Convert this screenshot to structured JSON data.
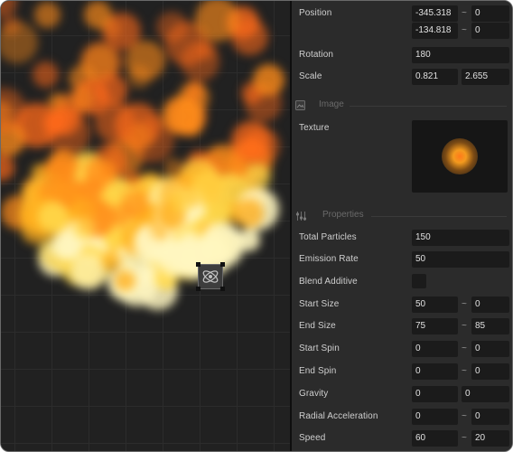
{
  "canvas": {
    "emitter_icon": "atom-icon",
    "particle_colors": [
      "#ff6a1a",
      "#ff8c1a",
      "#ffb020",
      "#ffd84a",
      "#fff6c0"
    ]
  },
  "inspector": {
    "position": {
      "label": "Position",
      "x": "-345.318",
      "x_var": "0",
      "y": "-134.818",
      "y_var": "0",
      "sep": "~"
    },
    "rotation": {
      "label": "Rotation",
      "value": "180"
    },
    "scale": {
      "label": "Scale",
      "x": "0.821",
      "y": "2.655"
    },
    "image_section": {
      "title": "Image",
      "icon": "image-icon"
    },
    "texture": {
      "label": "Texture"
    },
    "properties_section": {
      "title": "Properties",
      "icon": "sliders-icon"
    },
    "total_particles": {
      "label": "Total Particles",
      "value": "150"
    },
    "emission_rate": {
      "label": "Emission Rate",
      "value": "50"
    },
    "blend_additive": {
      "label": "Blend Additive",
      "checked": false
    },
    "start_size": {
      "label": "Start Size",
      "value": "50",
      "var": "0",
      "sep": "~"
    },
    "end_size": {
      "label": "End Size",
      "value": "75",
      "var": "85",
      "sep": "~"
    },
    "start_spin": {
      "label": "Start Spin",
      "value": "0",
      "var": "0",
      "sep": "~"
    },
    "end_spin": {
      "label": "End Spin",
      "value": "0",
      "var": "0",
      "sep": "~"
    },
    "gravity": {
      "label": "Gravity",
      "x": "0",
      "y": "0"
    },
    "radial_acceleration": {
      "label": "Radial Acceleration",
      "value": "0",
      "var": "0",
      "sep": "~"
    },
    "speed": {
      "label": "Speed",
      "value": "60",
      "var": "20",
      "sep": "~"
    }
  }
}
